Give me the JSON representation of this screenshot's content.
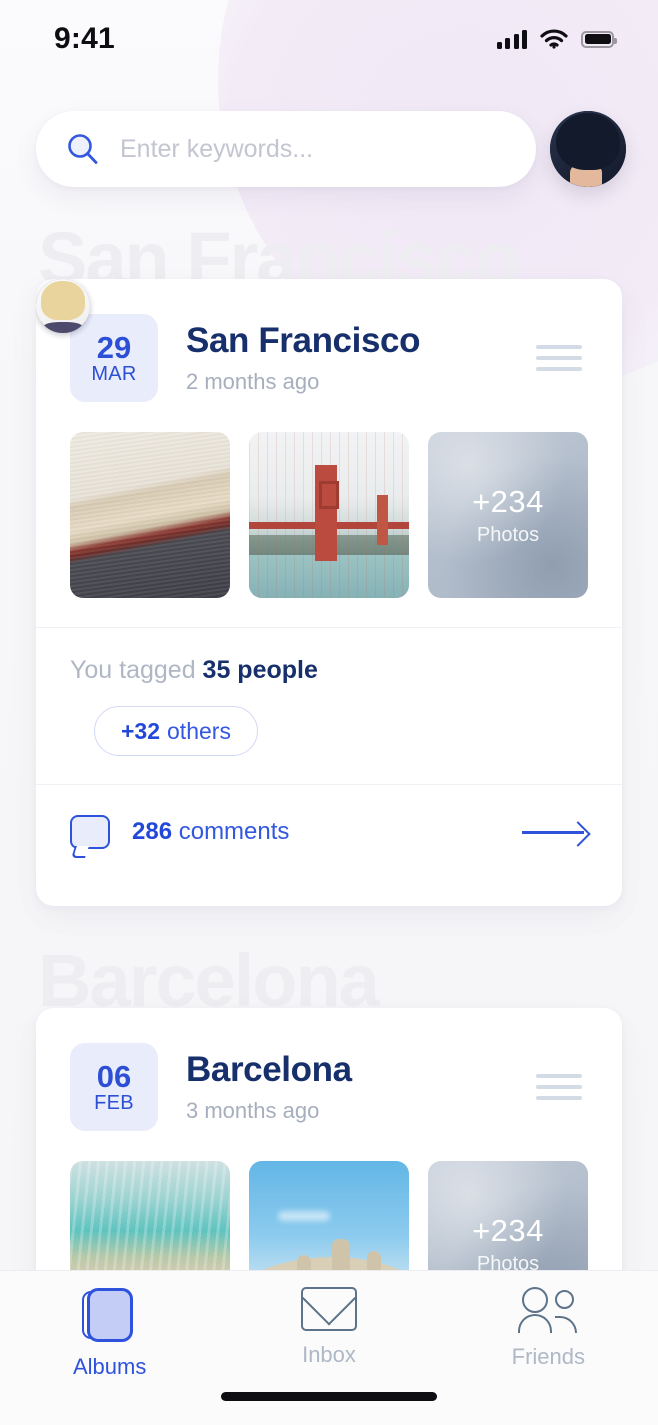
{
  "status_bar": {
    "time": "9:41",
    "signal_icon": "signal-bars-icon",
    "wifi_icon": "wifi-icon",
    "battery_icon": "battery-full-icon"
  },
  "search": {
    "placeholder": "Enter keywords...",
    "value": "",
    "icon": "search-icon"
  },
  "header": {
    "avatar": "user-avatar"
  },
  "watermarks": {
    "first": "San Francisco",
    "second": "Barcelona"
  },
  "cards": [
    {
      "date_day": "29",
      "date_month": "MAR",
      "title": "San Francisco",
      "subtitle": "2 months ago",
      "menu_icon": "menu-lines-icon",
      "thumbnails": [
        {
          "name": "photo-architecture"
        },
        {
          "name": "photo-golden-gate-bridge"
        }
      ],
      "more_tile": {
        "count": "+234",
        "label": "Photos"
      },
      "tagged": {
        "prefix": "You tagged ",
        "count": "35 people",
        "avatars": [
          "tagged-avatar-1",
          "tagged-avatar-2",
          "tagged-avatar-3"
        ],
        "others_count": "+32",
        "others_label": "others"
      },
      "comments": {
        "icon": "comment-bubble-icon",
        "count": "286",
        "label": "comments",
        "arrow": "arrow-right-icon"
      }
    },
    {
      "date_day": "06",
      "date_month": "FEB",
      "title": "Barcelona",
      "subtitle": "3 months ago",
      "menu_icon": "menu-lines-icon",
      "thumbnails": [
        {
          "name": "photo-beach-aerial"
        },
        {
          "name": "photo-casa-mila-rooftop"
        }
      ],
      "more_tile": {
        "count": "+234",
        "label": "Photos"
      }
    }
  ],
  "tab_bar": {
    "tabs": [
      {
        "label": "Albums",
        "icon": "albums-icon",
        "active": true
      },
      {
        "label": "Inbox",
        "icon": "envelope-icon",
        "active": false
      },
      {
        "label": "Friends",
        "icon": "people-icon",
        "active": false
      }
    ]
  },
  "colors": {
    "accent_blue": "#2f52dd",
    "title_navy": "#17306b",
    "muted_gray": "#a7aebd",
    "badge_bg": "#e9ecfa",
    "page_bg": "#f7f7f9"
  }
}
